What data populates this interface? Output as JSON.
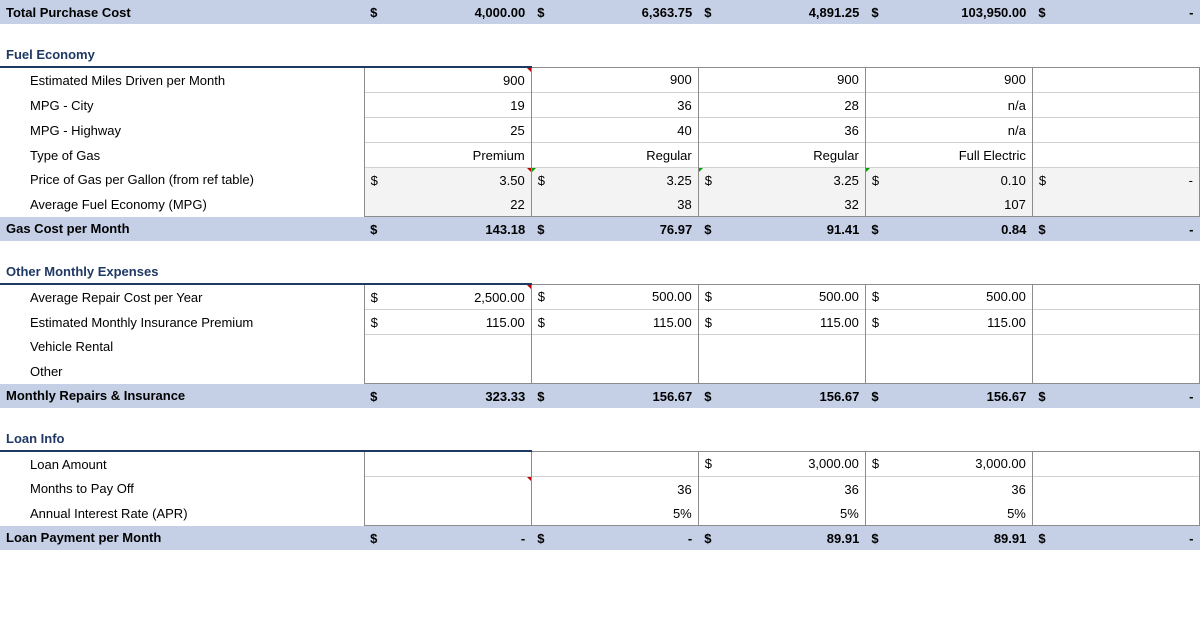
{
  "col_count": 5,
  "totalPurchase": {
    "label": "Total Purchase Cost",
    "values": [
      "4,000.00",
      "6,363.75",
      "4,891.25",
      "103,950.00",
      "-"
    ],
    "sym": [
      "$",
      "$",
      "$",
      "$",
      "$"
    ]
  },
  "fuel": {
    "header": "Fuel Economy",
    "rows": [
      {
        "label": "Estimated Miles Driven per Month",
        "marker": [
          0
        ],
        "values": [
          "900",
          "900",
          "900",
          "900",
          ""
        ]
      },
      {
        "label": "MPG - City",
        "values": [
          "19",
          "36",
          "28",
          "n/a",
          ""
        ]
      },
      {
        "label": "MPG - Highway",
        "values": [
          "25",
          "40",
          "36",
          "n/a",
          ""
        ]
      },
      {
        "label": "Type of Gas",
        "values": [
          "Premium",
          "Regular",
          "Regular",
          "Full Electric",
          ""
        ]
      },
      {
        "label": "Price of Gas per Gallon (from ref table)",
        "marker": [
          0
        ],
        "calc": true,
        "currency": true,
        "greenMarker": [
          1,
          2,
          3
        ],
        "values": [
          "3.50",
          "3.25",
          "3.25",
          "0.10",
          "-"
        ]
      },
      {
        "label": "Average Fuel Economy (MPG)",
        "calc": true,
        "values": [
          "22",
          "38",
          "32",
          "107",
          ""
        ]
      }
    ],
    "summary": {
      "label": "Gas Cost per Month",
      "values": [
        "143.18",
        "76.97",
        "91.41",
        "0.84",
        "-"
      ],
      "sym": [
        "$",
        "$",
        "$",
        "$",
        "$"
      ]
    }
  },
  "other": {
    "header": "Other Monthly Expenses",
    "rows": [
      {
        "label": "Average Repair Cost per Year",
        "marker": [
          0
        ],
        "currency": true,
        "values": [
          "2,500.00",
          "500.00",
          "500.00",
          "500.00",
          ""
        ]
      },
      {
        "label": "Estimated Monthly Insurance Premium",
        "currency": true,
        "values": [
          "115.00",
          "115.00",
          "115.00",
          "115.00",
          ""
        ]
      },
      {
        "label": "Vehicle Rental",
        "values": [
          "",
          "",
          "",
          "",
          ""
        ]
      },
      {
        "label": "Other",
        "values": [
          "",
          "",
          "",
          "",
          ""
        ]
      }
    ],
    "summary": {
      "label": "Monthly Repairs & Insurance",
      "values": [
        "323.33",
        "156.67",
        "156.67",
        "156.67",
        "-"
      ],
      "sym": [
        "$",
        "$",
        "$",
        "$",
        "$"
      ]
    }
  },
  "loan": {
    "header": "Loan Info",
    "rows": [
      {
        "label": "Loan Amount",
        "currency": true,
        "values": [
          "",
          "",
          "3,000.00",
          "3,000.00",
          ""
        ]
      },
      {
        "label": "Months to Pay Off",
        "marker": [
          0
        ],
        "values": [
          "",
          "36",
          "36",
          "36",
          ""
        ]
      },
      {
        "label": "Annual Interest Rate (APR)",
        "values": [
          "",
          "5%",
          "5%",
          "5%",
          ""
        ]
      }
    ],
    "summary": {
      "label": "Loan Payment per Month",
      "values": [
        "-",
        "-",
        "89.91",
        "89.91",
        "-"
      ],
      "sym": [
        "$",
        "$",
        "$",
        "$",
        "$"
      ]
    }
  }
}
